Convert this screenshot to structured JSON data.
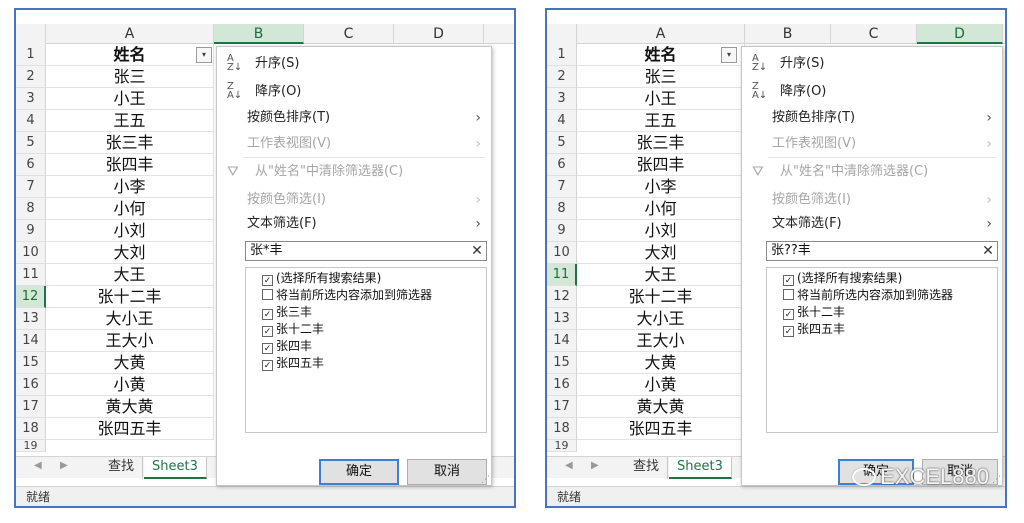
{
  "left": {
    "columns": [
      "A",
      "B",
      "C",
      "D"
    ],
    "rows": [
      {
        "num": "1",
        "value": "姓名"
      },
      {
        "num": "2",
        "value": "张三"
      },
      {
        "num": "3",
        "value": "小王"
      },
      {
        "num": "4",
        "value": "王五"
      },
      {
        "num": "5",
        "value": "张三丰"
      },
      {
        "num": "6",
        "value": "张四丰"
      },
      {
        "num": "7",
        "value": "小李"
      },
      {
        "num": "8",
        "value": "小何"
      },
      {
        "num": "9",
        "value": "小刘"
      },
      {
        "num": "10",
        "value": "大刘"
      },
      {
        "num": "11",
        "value": "大王"
      },
      {
        "num": "12",
        "value": "张十二丰"
      },
      {
        "num": "13",
        "value": "大小王"
      },
      {
        "num": "14",
        "value": "王大小"
      },
      {
        "num": "15",
        "value": "大黄"
      },
      {
        "num": "16",
        "value": "小黄"
      },
      {
        "num": "17",
        "value": "黄大黄"
      },
      {
        "num": "18",
        "value": "张四五丰"
      },
      {
        "num": "19",
        "value": ""
      }
    ],
    "sheet_tabs": [
      "查找",
      "Sheet3"
    ],
    "status": "就绪",
    "menu": {
      "sort_asc": "升序(S)",
      "sort_desc": "降序(O)",
      "sort_by_color": "按颜色排序(T)",
      "sheet_view": "工作表视图(V)",
      "clear_filter": "从\"姓名\"中清除筛选器(C)",
      "filter_by_color": "按颜色筛选(I)",
      "text_filter": "文本筛选(F)",
      "search_value": "张*丰",
      "items": [
        "(选择所有搜索结果)",
        "将当前所选内容添加到筛选器",
        "张三丰",
        "张十二丰",
        "张四丰",
        "张四五丰"
      ],
      "ok": "确定",
      "cancel": "取消"
    }
  },
  "right": {
    "columns": [
      "A",
      "B",
      "C",
      "D"
    ],
    "rows": [
      {
        "num": "1",
        "value": "姓名"
      },
      {
        "num": "2",
        "value": "张三"
      },
      {
        "num": "3",
        "value": "小王"
      },
      {
        "num": "4",
        "value": "王五"
      },
      {
        "num": "5",
        "value": "张三丰"
      },
      {
        "num": "6",
        "value": "张四丰"
      },
      {
        "num": "7",
        "value": "小李"
      },
      {
        "num": "8",
        "value": "小何"
      },
      {
        "num": "9",
        "value": "小刘"
      },
      {
        "num": "10",
        "value": "大刘"
      },
      {
        "num": "11",
        "value": "大王"
      },
      {
        "num": "12",
        "value": "张十二丰"
      },
      {
        "num": "13",
        "value": "大小王"
      },
      {
        "num": "14",
        "value": "王大小"
      },
      {
        "num": "15",
        "value": "大黄"
      },
      {
        "num": "16",
        "value": "小黄"
      },
      {
        "num": "17",
        "value": "黄大黄"
      },
      {
        "num": "18",
        "value": "张四五丰"
      },
      {
        "num": "19",
        "value": ""
      }
    ],
    "sheet_tabs": [
      "查找",
      "Sheet3"
    ],
    "status": "就绪",
    "menu": {
      "sort_asc": "升序(S)",
      "sort_desc": "降序(O)",
      "sort_by_color": "按颜色排序(T)",
      "sheet_view": "工作表视图(V)",
      "clear_filter": "从\"姓名\"中清除筛选器(C)",
      "filter_by_color": "按颜色筛选(I)",
      "text_filter": "文本筛选(F)",
      "search_value": "张??丰",
      "items": [
        "(选择所有搜索结果)",
        "将当前所选内容添加到筛选器",
        "张十二丰",
        "张四五丰"
      ],
      "ok": "确定",
      "cancel": "取消"
    }
  },
  "watermark": "EXCEL880"
}
